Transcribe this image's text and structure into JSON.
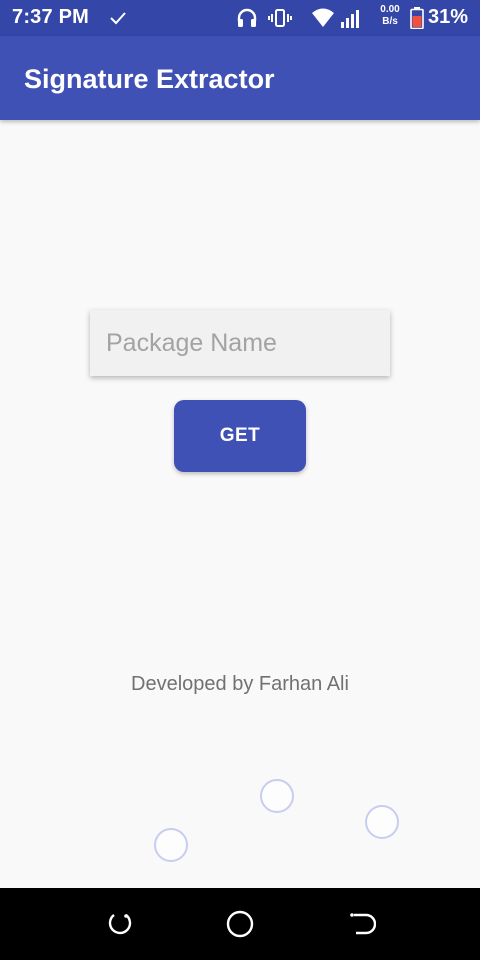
{
  "status_bar": {
    "time": "7:37 PM",
    "net_speed_value": "0.00",
    "net_speed_unit": "B/s",
    "battery": "31%",
    "icons": [
      "check-icon",
      "headset-icon",
      "vibrate-icon",
      "wifi-icon",
      "signal-icon",
      "battery-icon"
    ]
  },
  "app_bar": {
    "title": "Signature Extractor"
  },
  "form": {
    "package_placeholder": "Package Name",
    "package_value": "",
    "get_label": "GET"
  },
  "footer": {
    "credit": "Developed by Farhan Ali"
  },
  "nav_bar": {
    "icons": [
      "recent-apps-icon",
      "home-icon",
      "back-icon"
    ]
  },
  "colors": {
    "status_bar": "#3446a8",
    "primary": "#3f51b5",
    "background": "#f9f9f9",
    "bubble_border": "#c8cdf0"
  }
}
